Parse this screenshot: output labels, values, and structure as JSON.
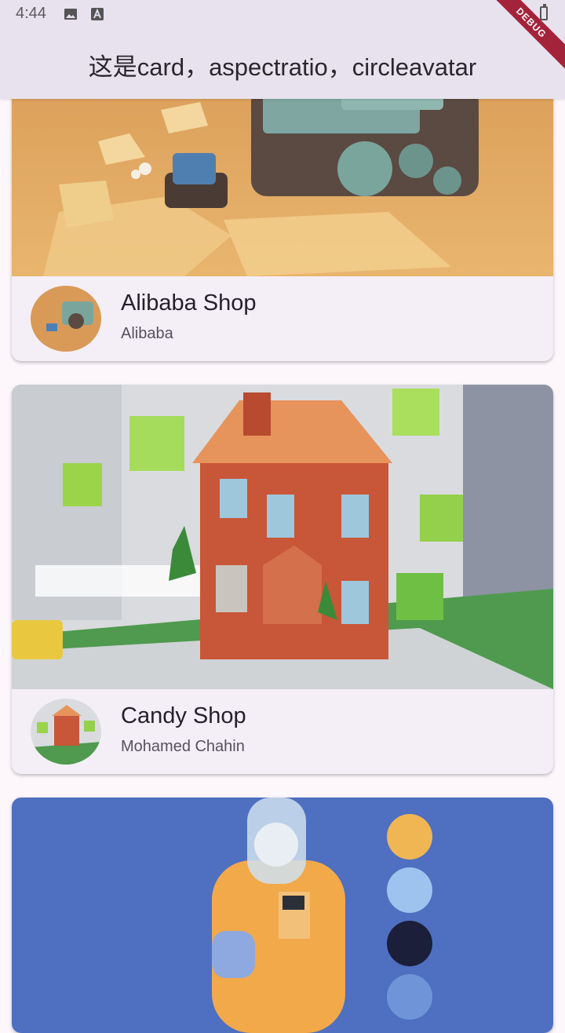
{
  "status_bar": {
    "time": "4:44",
    "icons": [
      "image-icon",
      "text-a-icon",
      "battery-charging-icon"
    ]
  },
  "app_bar": {
    "title": "这是card，aspectratio，circleavatar"
  },
  "debug_banner": "DEBUG",
  "cards": [
    {
      "title": "Alibaba Shop",
      "subtitle": "Alibaba"
    },
    {
      "title": "Candy Shop",
      "subtitle": "Mohamed Chahin"
    }
  ],
  "colors": {
    "app_bar_bg": "#e8e2ef",
    "page_bg": "#fdf7fc",
    "card_bg": "#f4eff6",
    "debug_red": "#a3243a"
  }
}
